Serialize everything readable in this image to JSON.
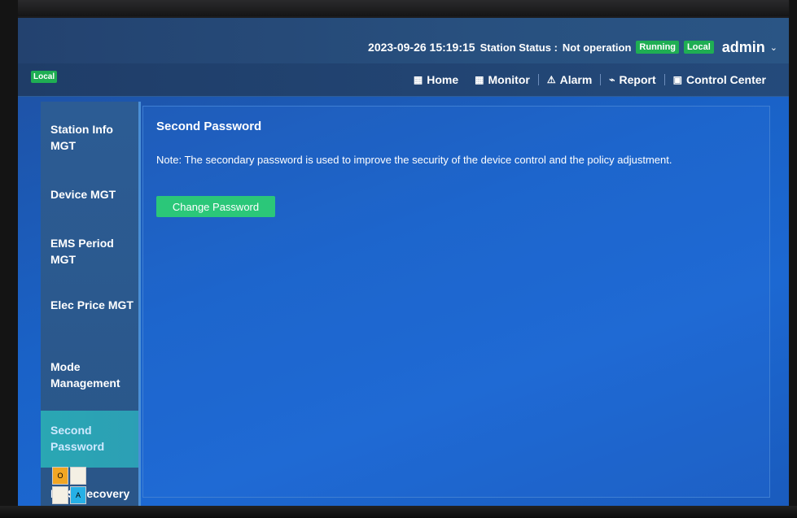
{
  "header": {
    "datetime": "2023-09-26 15:19:15",
    "station_status_label": "Station Status :",
    "station_status_value": "Not operation",
    "running_badge": "Running",
    "local_badge": "Local",
    "user": "admin",
    "user_caret": "⌄"
  },
  "navbar": {
    "local_chip": "Local",
    "items": [
      {
        "icon": "▦",
        "label": "Home"
      },
      {
        "icon": "▦",
        "label": "Monitor"
      },
      {
        "icon": "⚠",
        "label": "Alarm"
      },
      {
        "icon": "⌁",
        "label": "Report"
      },
      {
        "icon": "▣",
        "label": "Control Center"
      }
    ]
  },
  "sidebar": {
    "items": [
      {
        "label": "Station Info MGT"
      },
      {
        "label": "Device MGT"
      },
      {
        "label": "EMS Period MGT"
      },
      {
        "label": "Elec Price MGT"
      },
      {
        "label": "Mode Management"
      },
      {
        "label": "Second Password"
      },
      {
        "label": "EMS Recovery"
      }
    ]
  },
  "main": {
    "title": "Second Password",
    "note": "Note: The secondary password is used to improve the security of the device control and the policy adjustment.",
    "change_button": "Change Password"
  },
  "widget": {
    "cell1": "O",
    "cell4": "A"
  },
  "colors": {
    "badge_green": "#1fae53",
    "button_green": "#2bc779",
    "active_item": "#2aa7b3",
    "screen_blue": "#1a62c7"
  }
}
